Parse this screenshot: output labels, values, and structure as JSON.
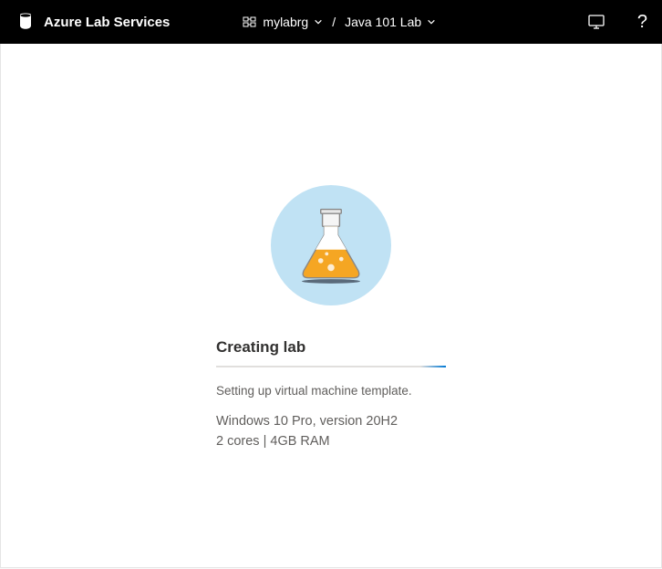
{
  "header": {
    "brand": "Azure Lab Services",
    "breadcrumbs": {
      "resource_group": "mylabrg",
      "separator": "/",
      "lab_name": "Java 101 Lab"
    }
  },
  "status": {
    "title": "Creating lab",
    "subtitle": "Setting up virtual machine template.",
    "os_spec": "Windows 10 Pro, version 20H2",
    "hw_spec": "2 cores | 4GB RAM"
  }
}
